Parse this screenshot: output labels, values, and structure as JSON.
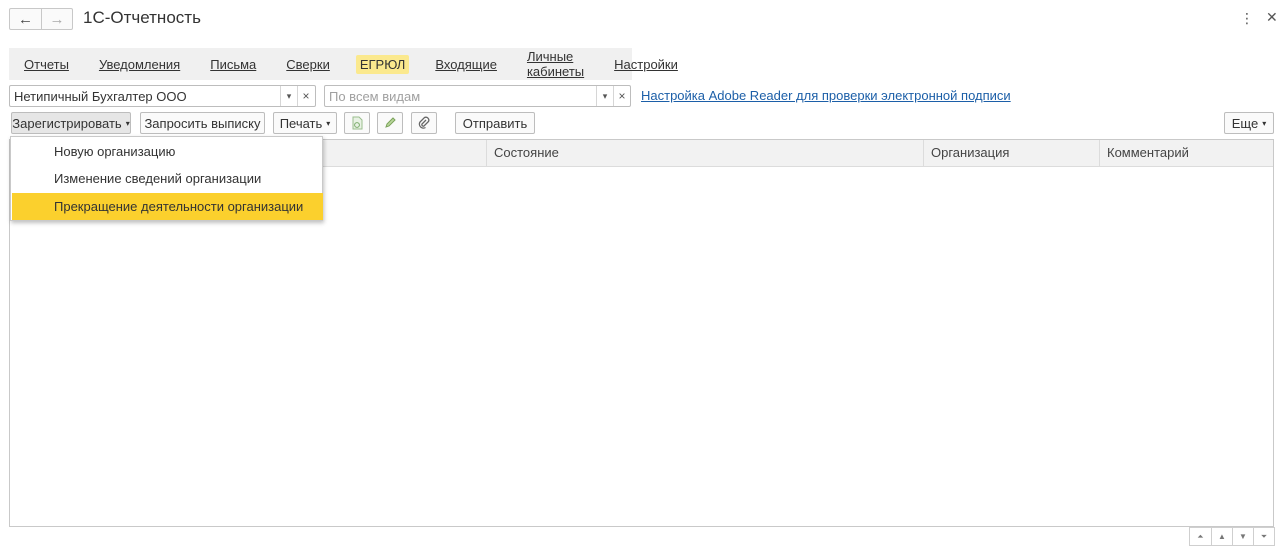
{
  "window": {
    "title": "1С-Отчетность",
    "back_icon": "←",
    "forward_icon": "→",
    "more_icon": "⋮",
    "close_icon": "✕"
  },
  "tabs": [
    {
      "label": "Отчеты",
      "active": false
    },
    {
      "label": "Уведомления",
      "active": false
    },
    {
      "label": "Письма",
      "active": false
    },
    {
      "label": "Сверки",
      "active": false
    },
    {
      "label": "ЕГРЮЛ",
      "active": true
    },
    {
      "label": "Входящие",
      "active": false
    },
    {
      "label": "Личные кабинеты",
      "active": false
    },
    {
      "label": "Настройки",
      "active": false
    }
  ],
  "filters": {
    "organization_value": "Нетипичный Бухгалтер ООО",
    "kind_placeholder": "По всем видам",
    "dropdown_glyph": "▾",
    "clear_glyph": "×",
    "adobe_link": "Настройка Adobe Reader для проверки электронной подписи"
  },
  "toolbar": {
    "register_label": "Зарегистрировать",
    "request_label": "Запросить выписку",
    "print_label": "Печать",
    "send_label": "Отправить",
    "more_label": "Еще",
    "caret": "▾"
  },
  "table": {
    "columns": [
      "",
      "Состояние",
      "Организация",
      "Комментарий"
    ]
  },
  "register_menu": {
    "items": [
      {
        "label": "Новую организацию",
        "highlighted": false
      },
      {
        "label": "Изменение сведений организации",
        "highlighted": false
      },
      {
        "label": "Прекращение деятельности организации",
        "highlighted": true
      }
    ]
  },
  "scroll": {
    "first": "⏶",
    "up": "▲",
    "down": "▼",
    "last": "⏷"
  },
  "colors": {
    "active_tab": "#fbe98e",
    "menu_highlight": "#fbd02d",
    "link": "#1c5fa8"
  }
}
